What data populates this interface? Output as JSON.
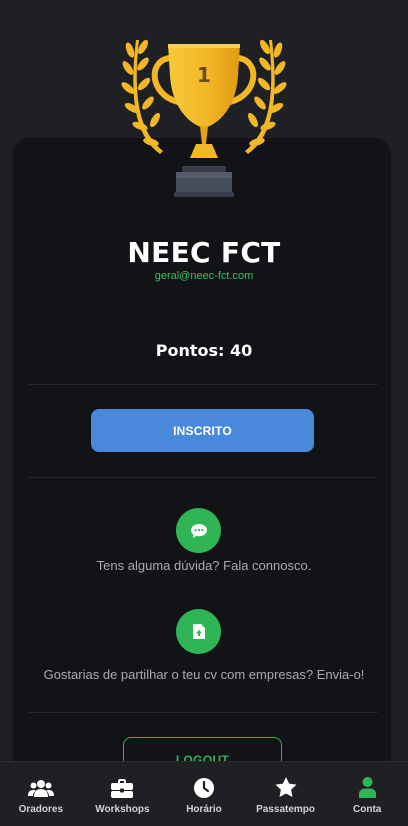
{
  "profile": {
    "rank": "1",
    "name": "NEEC FCT",
    "email": "geral@neec-fct.com",
    "points_label": "Pontos: 40"
  },
  "actions": {
    "inscrito_label": "INSCRITO",
    "contact_text": "Tens alguma dúvida? Fala connosco.",
    "cv_text": "Gostarias de partilhar o teu cv com empresas? Envia-o!",
    "logout_label": "LOGOUT"
  },
  "tabbar": {
    "items": [
      {
        "label": "Oradores",
        "icon": "users-icon"
      },
      {
        "label": "Workshops",
        "icon": "briefcase-icon"
      },
      {
        "label": "Horário",
        "icon": "clock-icon"
      },
      {
        "label": "Passatempo",
        "icon": "star-icon"
      },
      {
        "label": "Conta",
        "icon": "user-icon",
        "active": true
      }
    ]
  },
  "colors": {
    "background": "#1e2024",
    "card": "#121317",
    "accent_green": "#2fb456",
    "button_blue": "#4a88dc",
    "trophy_gold": "#f2b726"
  }
}
